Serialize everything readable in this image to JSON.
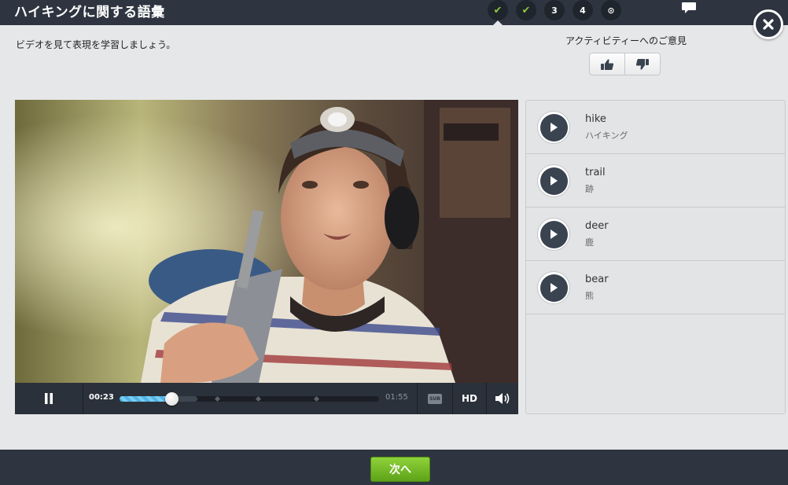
{
  "header": {
    "title": "ハイキングに関する語彙",
    "steps": [
      {
        "label": "✔",
        "state": "done"
      },
      {
        "label": "✔",
        "state": "done"
      },
      {
        "label": "3",
        "state": "pending"
      },
      {
        "label": "4",
        "state": "pending"
      },
      {
        "label": "⊙",
        "state": "pending"
      }
    ],
    "icons": {
      "chat": "speech-bubble-icon",
      "close": "close-icon"
    }
  },
  "instruction": "ビデオを見て表現を学習しましょう。",
  "feedback": {
    "label": "アクティビティーへのご意見",
    "icons": [
      "thumbs-up-icon",
      "thumbs-down-icon"
    ]
  },
  "player": {
    "current_time": "00:23",
    "total_time": "01:55",
    "progress": 0.2,
    "buffered": 0.3,
    "subtitles_label": "SUB",
    "hd_label": "HD",
    "icons": [
      "pause-icon",
      "subtitles-icon",
      "volume-icon"
    ]
  },
  "vocab": [
    {
      "term": "hike",
      "meaning": "ハイキング"
    },
    {
      "term": "trail",
      "meaning": "跡"
    },
    {
      "term": "deer",
      "meaning": "鹿"
    },
    {
      "term": "bear",
      "meaning": "熊"
    }
  ],
  "footer": {
    "next_label": "次へ"
  },
  "colors": {
    "bar": "#2e3540",
    "accent_green": "#8cc63f",
    "progress_blue": "#4fb4e8",
    "page_bg": "#e6e7e9"
  }
}
